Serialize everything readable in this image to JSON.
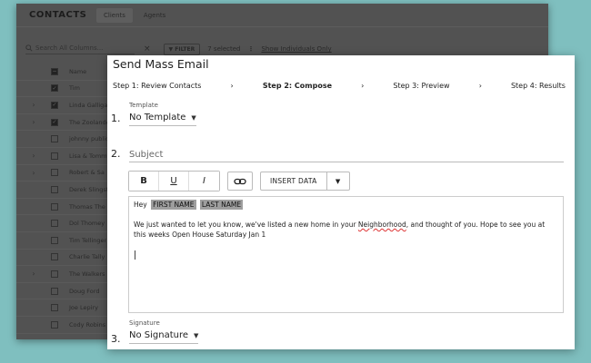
{
  "background": {
    "title": "CONTACTS",
    "tabs": [
      {
        "label": "Clients",
        "active": true
      },
      {
        "label": "Agents",
        "active": false
      }
    ],
    "search_placeholder": "Search All Columns...",
    "filter_label": "FILTER",
    "selected_text": "7 selected",
    "show_individuals": "Show Individuals Only",
    "header_name": "Name",
    "rows": [
      {
        "name": "Tim",
        "expand": "",
        "checked": true
      },
      {
        "name": "Linda Galligar",
        "expand": "›",
        "checked": true
      },
      {
        "name": "The Zoolander",
        "expand": "›",
        "checked": true
      },
      {
        "name": "johnny public",
        "expand": "",
        "checked": false
      },
      {
        "name": "Lisa & Tommy",
        "expand": "›",
        "checked": false
      },
      {
        "name": "Robert & Sa",
        "expand": "›",
        "checked": false
      },
      {
        "name": "Derek Slingston",
        "expand": "",
        "checked": false
      },
      {
        "name": "Thomas The",
        "expand": "",
        "checked": false
      },
      {
        "name": "Dol Thomey",
        "expand": "",
        "checked": false
      },
      {
        "name": "Tim Tellinger",
        "expand": "",
        "checked": false
      },
      {
        "name": "Charlie Tally",
        "expand": "",
        "checked": false
      },
      {
        "name": "The Walkers",
        "expand": "›",
        "checked": false
      },
      {
        "name": "Doug Ford",
        "expand": "",
        "checked": false
      },
      {
        "name": "Joe Lepiry",
        "expand": "",
        "checked": false
      },
      {
        "name": "Cody Robins",
        "expand": "",
        "checked": false
      }
    ]
  },
  "modal": {
    "title": "Send Mass Email",
    "steps": [
      {
        "label": "Step 1: Review Contacts",
        "current": false
      },
      {
        "label": "Step 2: Compose",
        "current": true
      },
      {
        "label": "Step 3: Preview",
        "current": false
      },
      {
        "label": "Step 4: Results",
        "current": false
      }
    ],
    "step_separator": "›",
    "template": {
      "number": "1.",
      "label": "Template",
      "value": "No Template"
    },
    "subject": {
      "number": "2.",
      "placeholder": "Subject"
    },
    "toolbar": {
      "bold": "B",
      "underline": "U",
      "italic": "I",
      "insert_data": "INSERT DATA"
    },
    "body": {
      "greeting": "Hey",
      "tag_first": "FIRST NAME",
      "tag_last": "LAST NAME",
      "para_before": "We just wanted to let you know, we've listed a new home in your ",
      "para_misspelled": "Neighborhood",
      "para_after": ", and thought of you. Hope to see you at this weeks Open House Saturday Jan 1"
    },
    "signature": {
      "number": "3.",
      "label": "Signature",
      "value": "No Signature"
    },
    "caret_glyph": "▼"
  }
}
